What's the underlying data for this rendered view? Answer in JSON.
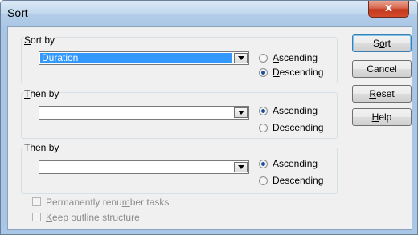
{
  "window": {
    "title": "Sort",
    "close_glyph": "x"
  },
  "sort_by": {
    "label_pre": "",
    "label_u": "S",
    "label_post": "ort by",
    "field_value": "Duration",
    "ascending": {
      "pre": "",
      "u": "A",
      "post": "scending",
      "checked": false
    },
    "descending": {
      "pre": "",
      "u": "D",
      "post": "escending",
      "checked": true
    }
  },
  "then_by_1": {
    "label_pre": "",
    "label_u": "T",
    "label_post": "hen by",
    "field_value": "",
    "ascending": {
      "pre": "As",
      "u": "c",
      "post": "ending",
      "checked": true
    },
    "descending": {
      "pre": "Desce",
      "u": "n",
      "post": "ding",
      "checked": false
    }
  },
  "then_by_2": {
    "label_pre": "Then ",
    "label_u": "b",
    "label_post": "y",
    "field_value": "",
    "ascending": {
      "pre": "Ascend",
      "u": "i",
      "post": "ng",
      "checked": true
    },
    "descending": {
      "pre": "Descendin",
      "u": "g",
      "post": "",
      "checked": false
    }
  },
  "buttons": {
    "sort": {
      "pre": "S",
      "u": "o",
      "post": "rt"
    },
    "cancel": {
      "pre": "Cancel",
      "u": "",
      "post": ""
    },
    "reset": {
      "pre": "",
      "u": "R",
      "post": "eset"
    },
    "help": {
      "pre": "",
      "u": "H",
      "post": "elp"
    }
  },
  "options": {
    "renumber": {
      "pre": "Permanently renu",
      "u": "m",
      "post": "ber tasks",
      "checked": false
    },
    "outline": {
      "pre": "",
      "u": "K",
      "post": "eep outline structure",
      "checked": false
    }
  }
}
